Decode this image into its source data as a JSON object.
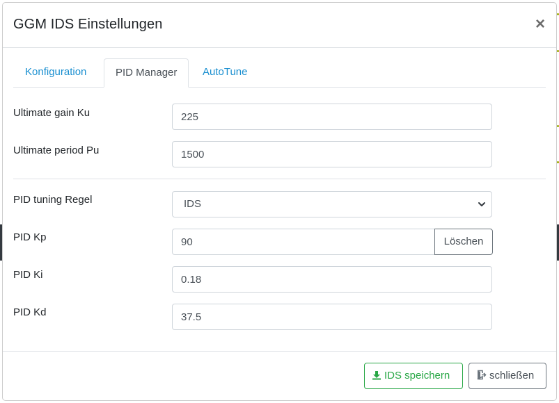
{
  "modal": {
    "title": "GGM IDS Einstellungen",
    "close_symbol": "×"
  },
  "tabs": [
    {
      "label": "Konfiguration",
      "active": false
    },
    {
      "label": "PID Manager",
      "active": true
    },
    {
      "label": "AutoTune",
      "active": false
    }
  ],
  "fields": {
    "ultimate_gain": {
      "label": "Ultimate gain Ku",
      "value": "225"
    },
    "ultimate_period": {
      "label": "Ultimate period Pu",
      "value": "1500"
    },
    "tuning_rule": {
      "label": "PID tuning Regel",
      "selected": "IDS"
    },
    "kp": {
      "label": "PID Kp",
      "value": "90",
      "button": "Löschen"
    },
    "ki": {
      "label": "PID Ki",
      "value": "0.18"
    },
    "kd": {
      "label": "PID Kd",
      "value": "37.5"
    }
  },
  "footer": {
    "save_label": "IDS speichern",
    "save_icon": "download-icon",
    "close_label": "schließen",
    "close_icon": "sign-out-icon"
  },
  "colors": {
    "accent": "#1a8fd0",
    "success": "#28a745",
    "secondary": "#6c757d"
  }
}
